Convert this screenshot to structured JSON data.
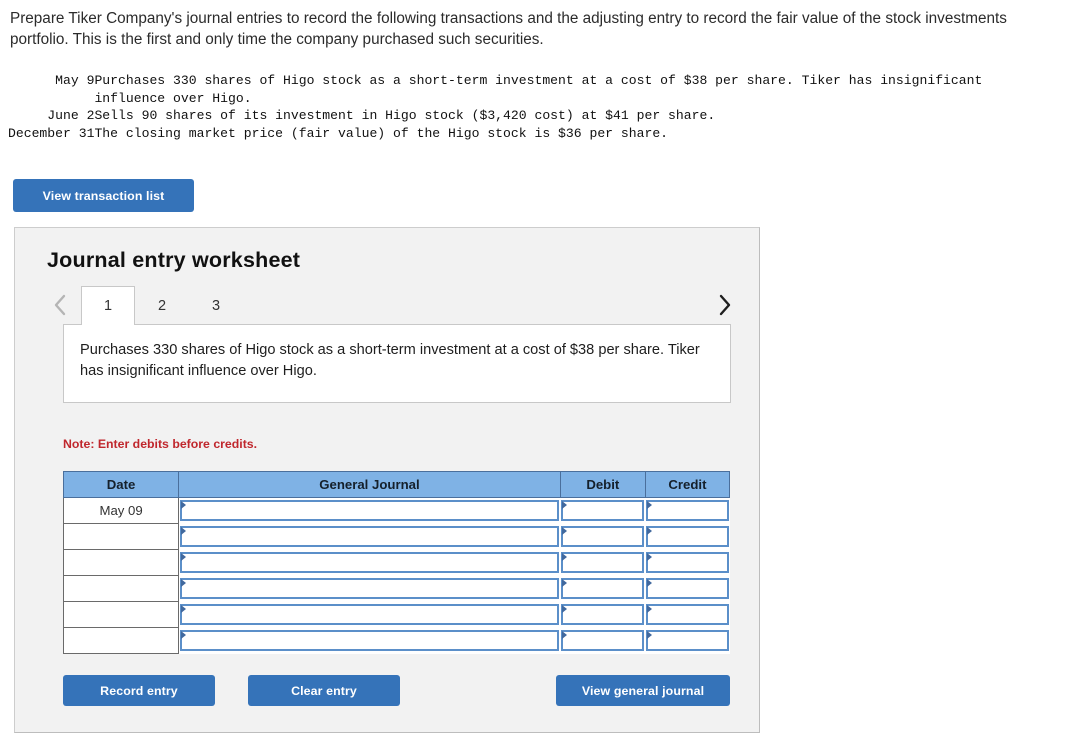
{
  "intro": {
    "paragraph": "Prepare Tiker Company's journal entries to record the following transactions and the adjusting entry to record the fair value of the stock investments portfolio. This is the first and only time the company purchased such securities."
  },
  "transactions": [
    {
      "date": "May 9",
      "description": "Purchases 330 shares of Higo stock as a short-term investment at a cost of $38 per share. Tiker has insignificant\ninfluence over Higo."
    },
    {
      "date": "June 2",
      "description": "Sells 90 shares of its investment in Higo stock ($3,420 cost) at $41 per share."
    },
    {
      "date": "December 31",
      "description": "The closing market price (fair value) of the Higo stock is $36 per share."
    }
  ],
  "buttons": {
    "view_transaction_list": "View transaction list",
    "record_entry": "Record entry",
    "clear_entry": "Clear entry",
    "view_general_journal": "View general journal"
  },
  "worksheet": {
    "title": "Journal entry worksheet",
    "prev_icon": "chevron-left-icon",
    "next_icon": "chevron-right-icon",
    "tabs": [
      {
        "label": "1",
        "active": true
      },
      {
        "label": "2",
        "active": false
      },
      {
        "label": "3",
        "active": false
      }
    ],
    "description": "Purchases 330 shares of Higo stock as a short-term investment at a cost of $38 per share. Tiker has insignificant influence over Higo.",
    "note": "Note: Enter debits before credits.",
    "table": {
      "columns": [
        "Date",
        "General Journal",
        "Debit",
        "Credit"
      ],
      "rows": [
        {
          "date": "May 09",
          "general_journal": "",
          "debit": "",
          "credit": ""
        },
        {
          "date": "",
          "general_journal": "",
          "debit": "",
          "credit": ""
        },
        {
          "date": "",
          "general_journal": "",
          "debit": "",
          "credit": ""
        },
        {
          "date": "",
          "general_journal": "",
          "debit": "",
          "credit": ""
        },
        {
          "date": "",
          "general_journal": "",
          "debit": "",
          "credit": ""
        },
        {
          "date": "",
          "general_journal": "",
          "debit": "",
          "credit": ""
        }
      ]
    }
  },
  "colors": {
    "button_blue": "#3573b9",
    "header_blue": "#7fb2e5",
    "panel_gray": "#f2f2f2",
    "note_red": "#c0272d",
    "cell_border_blue": "#5b8fc9"
  }
}
